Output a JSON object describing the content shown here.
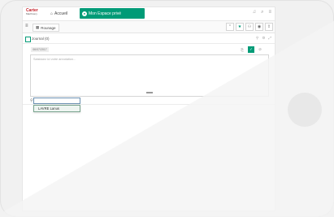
{
  "app": {
    "logo_line1": "Carter",
    "logo_line2": "Machinery",
    "nav_home_label": "Accueil",
    "active_tab_label": "Mon Espace privé",
    "active_tab_icon": "user-circle-icon",
    "header_icons": [
      "bell-icon",
      "search-icon",
      "menu-icon"
    ]
  },
  "toolbar": {
    "menu_icon": "hamburger-icon",
    "chip_label": "Rounage",
    "right_buttons": [
      "chevron-up-icon",
      "star-icon",
      "users-icon",
      "eye-icon",
      "export-icon"
    ]
  },
  "panel": {
    "title": "Journal (0)",
    "actions": [
      "filter-icon",
      "settings-icon",
      "expand-icon"
    ],
    "date_label": "06/07/2017",
    "note_placeholder": "Saisissez ici votre annotation...",
    "note_actions": [
      "attach-icon",
      "check-icon",
      "close-icon"
    ]
  },
  "assign": {
    "input_value": "",
    "suggestions": [
      "LAVRE Lanus"
    ]
  },
  "colors": {
    "accent": "#009b77",
    "brand_red": "#c4212a",
    "home_button": "#a4a4a4"
  }
}
